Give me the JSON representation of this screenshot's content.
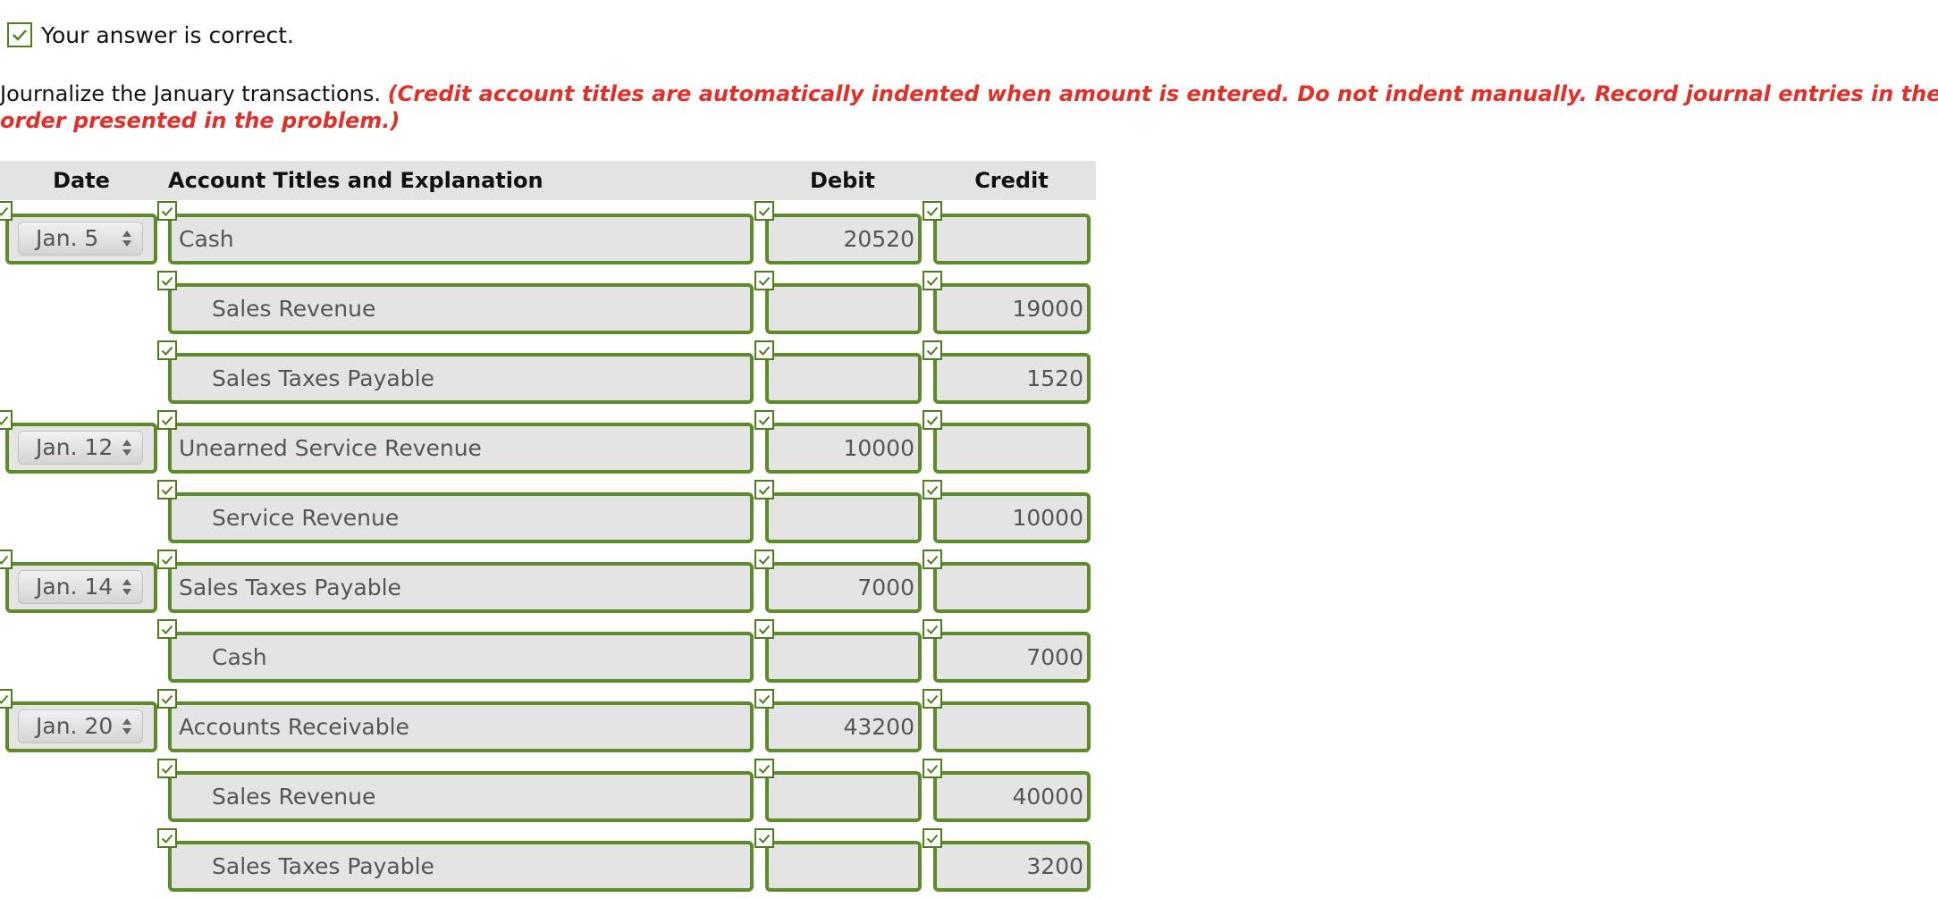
{
  "status": {
    "text": "Your answer is correct.",
    "icon": "check-icon"
  },
  "instructions": {
    "prompt": "Journalize the January transactions.",
    "note_line1": "(Credit account titles are automatically indented when amount is entered. Do not indent manually. Record journal entries in the",
    "note_line2": "order presented in the problem.)"
  },
  "table": {
    "headers": {
      "date": "Date",
      "account": "Account Titles and Explanation",
      "debit": "Debit",
      "credit": "Credit"
    },
    "rows": [
      {
        "date": "Jan. 5",
        "account": "Cash",
        "debit": "20520",
        "credit": "",
        "indent": false
      },
      {
        "date": "",
        "account": "Sales Revenue",
        "debit": "",
        "credit": "19000",
        "indent": true
      },
      {
        "date": "",
        "account": "Sales Taxes Payable",
        "debit": "",
        "credit": "1520",
        "indent": true
      },
      {
        "date": "Jan. 12",
        "account": "Unearned Service Revenue",
        "debit": "10000",
        "credit": "",
        "indent": false
      },
      {
        "date": "",
        "account": "Service Revenue",
        "debit": "",
        "credit": "10000",
        "indent": true
      },
      {
        "date": "Jan. 14",
        "account": "Sales Taxes Payable",
        "debit": "7000",
        "credit": "",
        "indent": false
      },
      {
        "date": "",
        "account": "Cash",
        "debit": "",
        "credit": "7000",
        "indent": true
      },
      {
        "date": "Jan. 20",
        "account": "Accounts Receivable",
        "debit": "43200",
        "credit": "",
        "indent": false
      },
      {
        "date": "",
        "account": "Sales Revenue",
        "debit": "",
        "credit": "40000",
        "indent": true
      },
      {
        "date": "",
        "account": "Sales Taxes Payable",
        "debit": "",
        "credit": "3200",
        "indent": true
      }
    ]
  },
  "colors": {
    "correct_border": "#5d8b2a",
    "note_red": "#e0302a",
    "field_bg": "#e4e4e4",
    "header_bg": "#e3e3e3"
  }
}
